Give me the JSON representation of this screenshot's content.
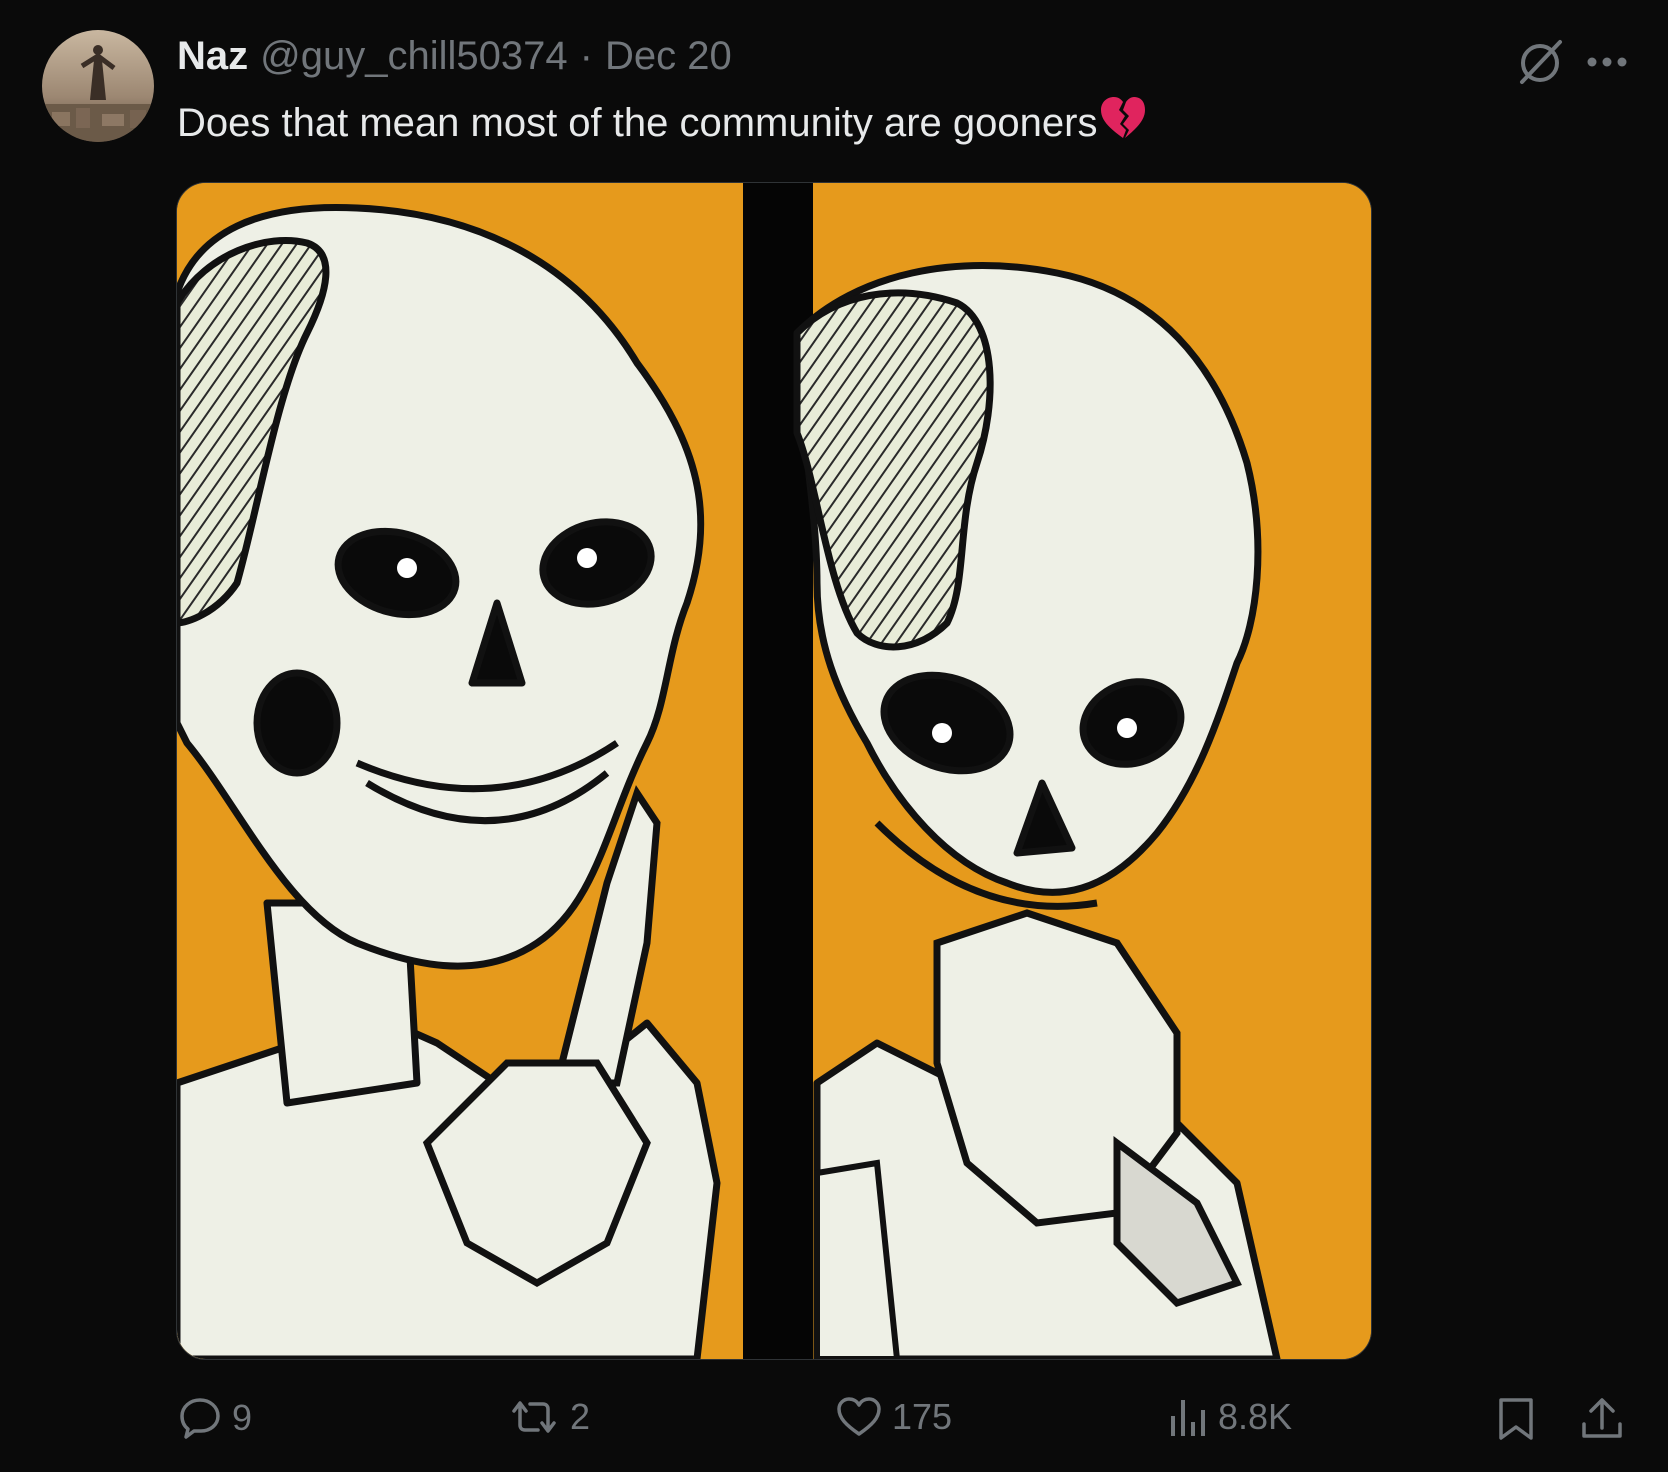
{
  "tweet": {
    "display_name": "Naz",
    "handle": "@guy_chill50374",
    "separator": "·",
    "date": "Dec 20",
    "text": "Does that mean most of the community are gooners",
    "emoji": "broken-heart"
  },
  "top_icons": [
    "grok-icon",
    "more-icon"
  ],
  "actions": {
    "replies": "9",
    "reposts": "2",
    "likes": "175",
    "views": "8.8K"
  },
  "colors": {
    "background": "#0a0a0a",
    "text_primary": "#e7e9ea",
    "text_secondary": "#71767b",
    "media_background": "#e69a1c"
  }
}
